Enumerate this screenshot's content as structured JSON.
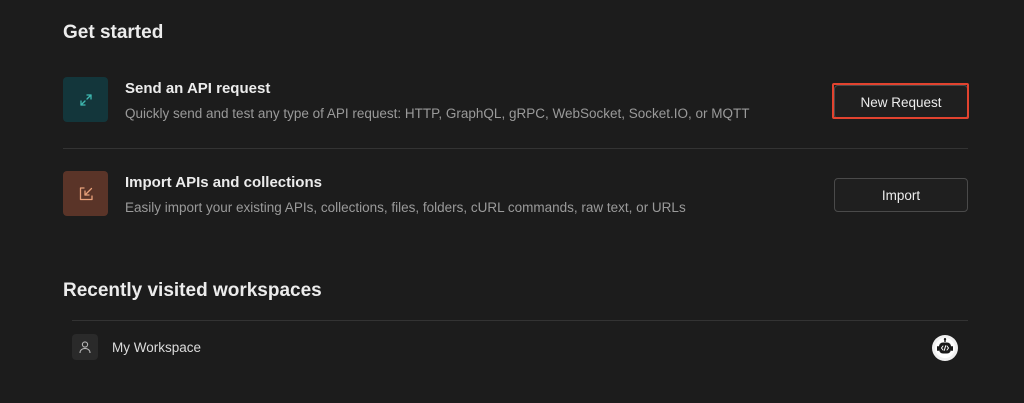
{
  "get_started": {
    "title": "Get started",
    "items": [
      {
        "icon": "api-request-icon",
        "title": "Send an API request",
        "description": "Quickly send and test any type of API request: HTTP, GraphQL, gRPC, WebSocket, Socket.IO, or MQTT",
        "button_label": "New Request",
        "accent": "#13363b"
      },
      {
        "icon": "import-icon",
        "title": "Import APIs and collections",
        "description": "Easily import your existing APIs, collections, files, folders, cURL commands, raw text, or URLs",
        "button_label": "Import",
        "accent": "#5a3428"
      }
    ]
  },
  "recent_workspaces": {
    "title": "Recently visited workspaces",
    "items": [
      {
        "icon": "user-icon",
        "name": "My Workspace",
        "badge_icon": "robot-code-icon"
      }
    ]
  },
  "colors": {
    "background": "#1c1c1c",
    "highlight": "#e2432f"
  }
}
